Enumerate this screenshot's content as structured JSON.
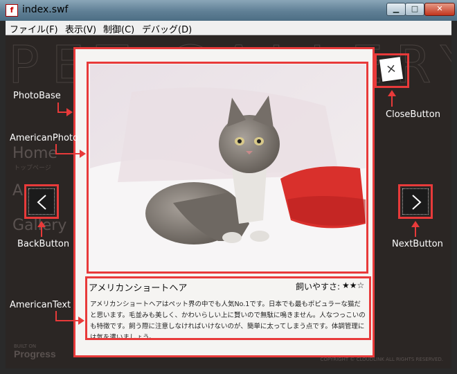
{
  "window": {
    "title": "index.swf",
    "app_icon": "flash-icon",
    "controls": {
      "minimize": "minimize-icon",
      "maximize": "maximize-icon",
      "close": "close-icon"
    }
  },
  "menubar": {
    "items": [
      {
        "label": "ファイル(F)"
      },
      {
        "label": "表示(V)"
      },
      {
        "label": "制御(C)"
      },
      {
        "label": "デバッグ(D)"
      }
    ]
  },
  "background": {
    "nav_home": "Home",
    "nav_home_sub": "トップページ",
    "nav_a": "A",
    "nav_gallery": "Gallery",
    "built_on": "BUILT ON",
    "progress": "Progress",
    "copyright": "COPYRIGHT © CLOUDLINK ALL RIGHTS RESERVED."
  },
  "callouts": {
    "photo_base": "PhotoBase",
    "american_photo": "AmericanPhoto",
    "american_text": "AmericanText",
    "close_button": "CloseButton",
    "back_button": "BackButton",
    "next_button": "NextButton"
  },
  "card": {
    "breed_name": "アメリカンショートヘア",
    "ease_label": "飼いやすさ:",
    "ease_stars": "★★☆",
    "ease_rating": 2,
    "ease_max": 3,
    "description": "アメリカンショートヘアはペット界の中でも人気No.1です。日本でも最もポピュラーな猫だと思います。毛並みも美しく、かわいらしい上に賢いので無駄に鳴きません。人なつっこいのも特徴です。飼う際に注意しなければいけないのが、簡単に太ってしまう点です。体調管理には気を遣いましょう。"
  },
  "buttons": {
    "close_glyph": "×",
    "back_icon": "chevron-left-icon",
    "next_icon": "chevron-right-icon"
  },
  "colors": {
    "annotation_red": "#e83a3a",
    "stage_bg": "#2b2624",
    "card_bg": "#f5f4f2"
  }
}
